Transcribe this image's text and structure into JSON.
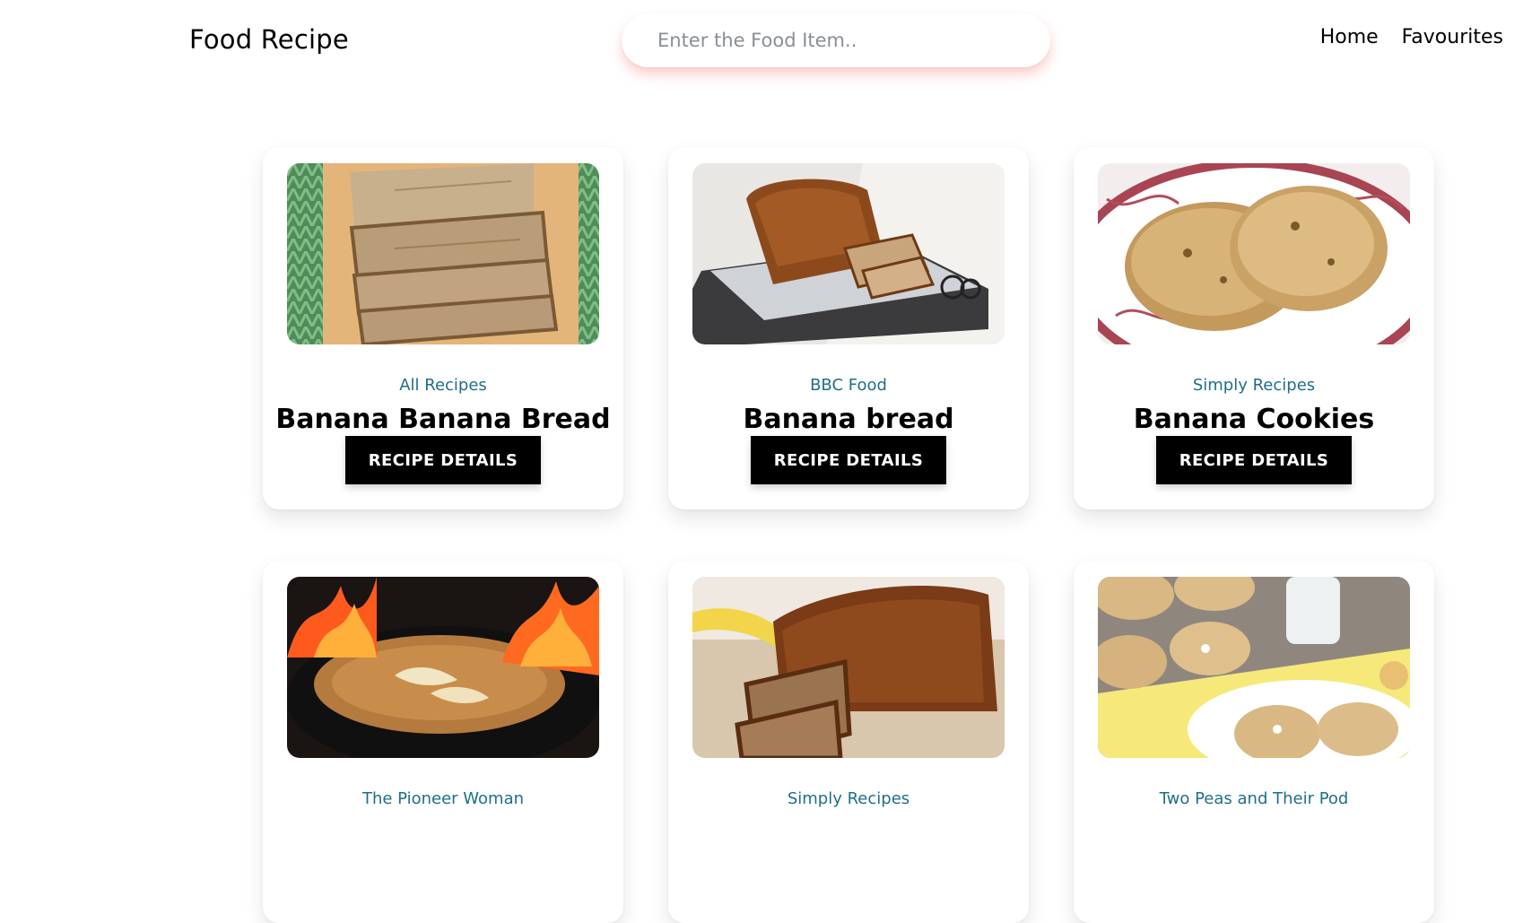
{
  "header": {
    "brand": "Food Recipe",
    "search_placeholder": "Enter the Food Item..",
    "nav": {
      "home": "Home",
      "favourites": "Favourites"
    }
  },
  "recipes": [
    {
      "source": "All Recipes",
      "title": "Banana Banana Bread",
      "button": "RECIPE DETAILS",
      "image": "banana-bread-slices-photo"
    },
    {
      "source": "BBC Food",
      "title": "Banana bread",
      "button": "RECIPE DETAILS",
      "image": "banana-bread-loaf-tray-photo"
    },
    {
      "source": "Simply Recipes",
      "title": "Banana Cookies",
      "button": "RECIPE DETAILS",
      "image": "banana-cookies-plate-photo"
    },
    {
      "source": "The Pioneer Woman",
      "image": "flambe-skillet-photo"
    },
    {
      "source": "Simply Recipes",
      "image": "banana-bread-cut-loaf-photo"
    },
    {
      "source": "Two Peas and Their Pod",
      "image": "white-chocolate-cookies-photo"
    }
  ],
  "colors": {
    "source_text": "#1e6f88",
    "button_bg": "#000000",
    "button_text": "#ffffff",
    "search_glow": "#ff5050"
  }
}
